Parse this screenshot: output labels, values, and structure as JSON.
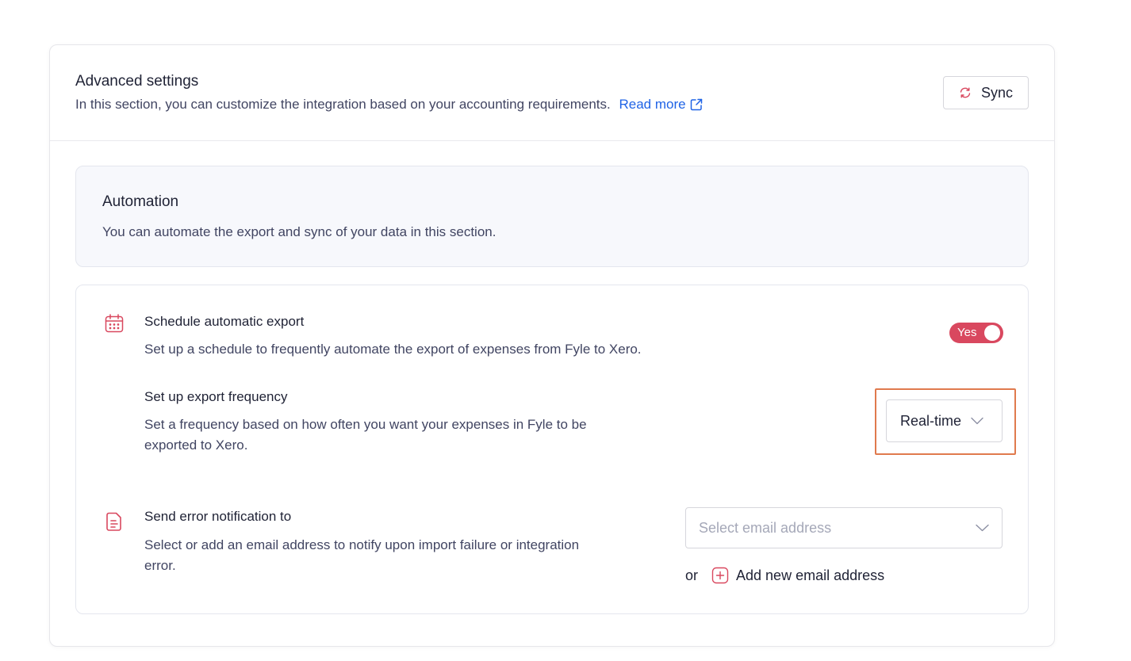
{
  "header": {
    "title": "Advanced settings",
    "subtitle": "In this section, you can customize the integration based on your accounting requirements.",
    "read_more": "Read more",
    "sync_label": "Sync"
  },
  "automation": {
    "title": "Automation",
    "description": "You can automate the export and sync of your data in this section."
  },
  "schedule": {
    "title": "Schedule automatic export",
    "description": "Set up a schedule to frequently automate the export of expenses from Fyle to Xero.",
    "toggle_label": "Yes",
    "toggle_on": true
  },
  "frequency": {
    "title": "Set up export frequency",
    "description_line1": "Set a frequency based on how often you want your expenses in Fyle to be",
    "description_line2": "exported to Xero.",
    "selected": "Real-time"
  },
  "notification": {
    "title": "Send error notification to",
    "description_line1": "Select or add an email address to notify upon import failure or integration",
    "description_line2": "error.",
    "placeholder": "Select email address",
    "or_text": "or",
    "add_label": "Add new email address"
  },
  "colors": {
    "accent": "#d9485f",
    "link": "#1f63e6",
    "highlight": "#e07a4d"
  },
  "icons": {
    "sync": "sync-icon",
    "external": "external-link-icon",
    "calendar": "calendar-icon",
    "document": "document-icon",
    "chevron": "chevron-down-icon",
    "add": "plus-square-icon"
  }
}
